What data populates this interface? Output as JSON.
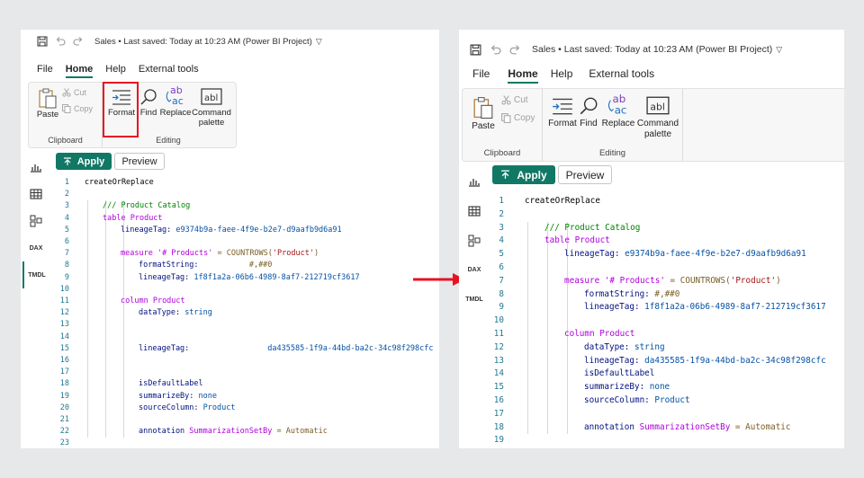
{
  "app": {
    "title": "Sales • Last saved: Today at 10:23 AM (Power BI Project)",
    "menus": [
      {
        "label": "File",
        "active": false
      },
      {
        "label": "Home",
        "active": true
      },
      {
        "label": "Help",
        "active": false
      },
      {
        "label": "External tools",
        "active": false
      }
    ],
    "ribbon": {
      "paste": "Paste",
      "cut": "Cut",
      "copy": "Copy",
      "clipboard_group": "Clipboard",
      "format": "Format",
      "find": "Find",
      "replace": "Replace",
      "command_line1": "Command",
      "command_line2": "palette",
      "editing_group": "Editing"
    },
    "toolbar": {
      "apply": "Apply",
      "preview": "Preview"
    },
    "rail": [
      "chart-icon",
      "table-icon",
      "model-icon",
      "dax-icon",
      "tmdl-icon"
    ],
    "rail_labels": {
      "dax": "DAX",
      "tmdl": "TMDL"
    },
    "colors": {
      "accent": "#117865",
      "highlight": "#e81123",
      "arrow": "#e81123"
    }
  },
  "before": {
    "lines": [
      {
        "n": "1",
        "indent": 0,
        "parts": [
          {
            "t": "createOrReplace",
            "c": "t-default"
          }
        ]
      },
      {
        "n": "2",
        "indent": 0,
        "parts": []
      },
      {
        "n": "3",
        "indent": 1,
        "parts": [
          {
            "t": "/// Product Catalog",
            "c": "t-comment"
          }
        ]
      },
      {
        "n": "4",
        "indent": 1,
        "parts": [
          {
            "t": "table ",
            "c": "t-keyword"
          },
          {
            "t": "Product",
            "c": "t-keyword"
          }
        ]
      },
      {
        "n": "5",
        "indent": 2,
        "parts": [
          {
            "t": "lineageTag: ",
            "c": "t-prop"
          },
          {
            "t": "e9374b9a-faee-4f9e-b2e7-d9aafb9d6a91",
            "c": "t-value"
          }
        ]
      },
      {
        "n": "6",
        "indent": 0,
        "parts": []
      },
      {
        "n": "7",
        "indent": 2,
        "parts": [
          {
            "t": "measure ",
            "c": "t-keyword"
          },
          {
            "t": "'# Products'",
            "c": "t-keyword"
          },
          {
            "t": " = COUNTROWS(",
            "c": "t-muted"
          },
          {
            "t": "'Product'",
            "c": "t-string"
          },
          {
            "t": ")",
            "c": "t-muted"
          }
        ]
      },
      {
        "n": "8",
        "indent": 3,
        "parts": [
          {
            "t": "formatString:           ",
            "c": "t-prop"
          },
          {
            "t": "#,##0",
            "c": "t-muted"
          }
        ]
      },
      {
        "n": "9",
        "indent": 3,
        "parts": [
          {
            "t": "lineageTag: ",
            "c": "t-prop"
          },
          {
            "t": "1f8f1a2a-06b6-4989-8af7-212719cf3617",
            "c": "t-value"
          }
        ]
      },
      {
        "n": "10",
        "indent": 0,
        "parts": []
      },
      {
        "n": "11",
        "indent": 2,
        "parts": [
          {
            "t": "column ",
            "c": "t-keyword"
          },
          {
            "t": "Product",
            "c": "t-keyword"
          }
        ]
      },
      {
        "n": "12",
        "indent": 3,
        "parts": [
          {
            "t": "dataType: ",
            "c": "t-prop"
          },
          {
            "t": "string",
            "c": "t-value"
          }
        ]
      },
      {
        "n": "13",
        "indent": 0,
        "parts": []
      },
      {
        "n": "14",
        "indent": 0,
        "parts": []
      },
      {
        "n": "15",
        "indent": 3,
        "parts": [
          {
            "t": "lineageTag:                 ",
            "c": "t-prop"
          },
          {
            "t": "da435585-1f9a-44bd-ba2c-34c98f298cfc",
            "c": "t-value"
          }
        ]
      },
      {
        "n": "16",
        "indent": 0,
        "parts": []
      },
      {
        "n": "17",
        "indent": 0,
        "parts": []
      },
      {
        "n": "18",
        "indent": 3,
        "parts": [
          {
            "t": "isDefaultLabel",
            "c": "t-prop"
          }
        ]
      },
      {
        "n": "19",
        "indent": 3,
        "parts": [
          {
            "t": "summarizeBy: ",
            "c": "t-prop"
          },
          {
            "t": "none",
            "c": "t-value"
          }
        ]
      },
      {
        "n": "20",
        "indent": 3,
        "parts": [
          {
            "t": "sourceColumn: ",
            "c": "t-prop"
          },
          {
            "t": "Product",
            "c": "t-value"
          }
        ]
      },
      {
        "n": "21",
        "indent": 0,
        "parts": []
      },
      {
        "n": "22",
        "indent": 3,
        "parts": [
          {
            "t": "annotation ",
            "c": "t-prop"
          },
          {
            "t": "SummarizationSetBy",
            "c": "t-keyword"
          },
          {
            "t": " = Automatic",
            "c": "t-muted"
          }
        ]
      },
      {
        "n": "23",
        "indent": 0,
        "parts": []
      }
    ]
  },
  "after": {
    "lines": [
      {
        "n": "1",
        "indent": 0,
        "parts": [
          {
            "t": "createOrReplace",
            "c": "t-default"
          }
        ]
      },
      {
        "n": "2",
        "indent": 0,
        "parts": []
      },
      {
        "n": "3",
        "indent": 1,
        "parts": [
          {
            "t": "/// Product Catalog",
            "c": "t-comment"
          }
        ]
      },
      {
        "n": "4",
        "indent": 1,
        "parts": [
          {
            "t": "table ",
            "c": "t-keyword"
          },
          {
            "t": "Product",
            "c": "t-keyword"
          }
        ]
      },
      {
        "n": "5",
        "indent": 2,
        "parts": [
          {
            "t": "lineageTag: ",
            "c": "t-prop"
          },
          {
            "t": "e9374b9a-faee-4f9e-b2e7-d9aafb9d6a91",
            "c": "t-value"
          }
        ]
      },
      {
        "n": "6",
        "indent": 0,
        "parts": []
      },
      {
        "n": "7",
        "indent": 2,
        "parts": [
          {
            "t": "measure ",
            "c": "t-keyword"
          },
          {
            "t": "'# Products'",
            "c": "t-keyword"
          },
          {
            "t": " = COUNTROWS(",
            "c": "t-muted"
          },
          {
            "t": "'Product'",
            "c": "t-string"
          },
          {
            "t": ")",
            "c": "t-muted"
          }
        ]
      },
      {
        "n": "8",
        "indent": 3,
        "parts": [
          {
            "t": "formatString: ",
            "c": "t-prop"
          },
          {
            "t": "#,##0",
            "c": "t-muted"
          }
        ]
      },
      {
        "n": "9",
        "indent": 3,
        "parts": [
          {
            "t": "lineageTag: ",
            "c": "t-prop"
          },
          {
            "t": "1f8f1a2a-06b6-4989-8af7-212719cf3617",
            "c": "t-value"
          }
        ]
      },
      {
        "n": "10",
        "indent": 0,
        "parts": []
      },
      {
        "n": "11",
        "indent": 2,
        "parts": [
          {
            "t": "column ",
            "c": "t-keyword"
          },
          {
            "t": "Product",
            "c": "t-keyword"
          }
        ]
      },
      {
        "n": "12",
        "indent": 3,
        "parts": [
          {
            "t": "dataType: ",
            "c": "t-prop"
          },
          {
            "t": "string",
            "c": "t-value"
          }
        ]
      },
      {
        "n": "13",
        "indent": 3,
        "parts": [
          {
            "t": "lineageTag: ",
            "c": "t-prop"
          },
          {
            "t": "da435585-1f9a-44bd-ba2c-34c98f298cfc",
            "c": "t-value"
          }
        ]
      },
      {
        "n": "14",
        "indent": 3,
        "parts": [
          {
            "t": "isDefaultLabel",
            "c": "t-prop"
          }
        ]
      },
      {
        "n": "15",
        "indent": 3,
        "parts": [
          {
            "t": "summarizeBy: ",
            "c": "t-prop"
          },
          {
            "t": "none",
            "c": "t-value"
          }
        ]
      },
      {
        "n": "16",
        "indent": 3,
        "parts": [
          {
            "t": "sourceColumn: ",
            "c": "t-prop"
          },
          {
            "t": "Product",
            "c": "t-value"
          }
        ]
      },
      {
        "n": "17",
        "indent": 0,
        "parts": []
      },
      {
        "n": "18",
        "indent": 3,
        "parts": [
          {
            "t": "annotation ",
            "c": "t-prop"
          },
          {
            "t": "SummarizationSetBy",
            "c": "t-keyword"
          },
          {
            "t": " = Automatic",
            "c": "t-muted"
          }
        ]
      },
      {
        "n": "19",
        "indent": 0,
        "parts": []
      }
    ]
  }
}
